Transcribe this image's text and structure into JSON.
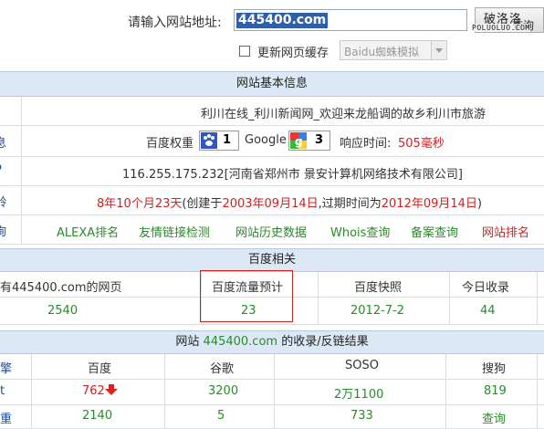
{
  "search": {
    "label": "请输入网站地址:",
    "value": "445400.com",
    "button_label": "破洛洛",
    "button_label_2": "查询",
    "watermark": "POLUOLUO.COM",
    "cache_label": "更新网页缓存",
    "ua_value": "Baidu蜘蛛模拟"
  },
  "basic": {
    "header": "网站基本信息",
    "title_text": "利川在线_利川新闻网_欢迎来龙船调的故乡利川市旅游",
    "rank_label": "百度权重",
    "baidu_rank": "1",
    "google_label": "Google",
    "google_rank": "3",
    "response_label": "响应时间:",
    "response_value": "505毫秒",
    "row_label_1": "息",
    "row_label_2": "P",
    "row_label_3": "龄",
    "row_label_4": "询",
    "ip_text": "116.255.175.232[河南省郑州市 景安计算机网络技术有限公司]",
    "age": "8年10个月23天",
    "created_prefix": "(创建于",
    "created_date": "2003年09月14日",
    "expire_prefix": ",过期时间为",
    "expire_date": "2012年09月14日",
    "expire_suffix": ")",
    "links": [
      "ALEXA排名",
      "友情链接检测",
      "网站历史数据",
      "Whois查询",
      "备案查询",
      "网站排名"
    ]
  },
  "baidu": {
    "header": "百度相关",
    "cols": [
      "有445400.com的网页",
      "百度流量预计",
      "百度快照",
      "今日收录"
    ],
    "values": [
      "2540",
      "23",
      "2012-7-2",
      "44"
    ]
  },
  "engines": {
    "header_prefix": "网站",
    "header_domain": "445400.com",
    "header_suffix": "的收录/反链结果",
    "left_label": "擎",
    "cols": [
      "百度",
      "谷歌",
      "SOSO",
      "搜狗"
    ],
    "row1_label": "t",
    "row1": [
      "762",
      "3200",
      "2万1100",
      "819"
    ],
    "row2_label": "重",
    "row2": [
      "2140",
      "5",
      "733",
      "查询"
    ]
  },
  "colors": {
    "accent_red": "#d02020",
    "link_green": "#2a8a2a",
    "header_bg": "#dce8f5",
    "highlight_box": "#cc2222"
  }
}
